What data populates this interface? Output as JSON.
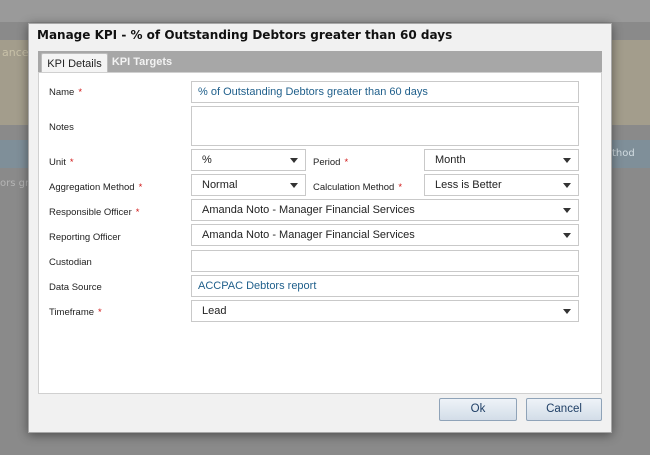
{
  "background": {
    "fragment_1": "ance",
    "fragment_2": "ors gre",
    "fragment_3": "thod"
  },
  "dialog": {
    "title": "Manage KPI - % of Outstanding Debtors greater than 60 days",
    "tabs": [
      {
        "label": "KPI Details",
        "active": true
      },
      {
        "label": "KPI Targets",
        "active": false
      }
    ],
    "fields": {
      "name": {
        "label": "Name",
        "required": true,
        "value": "% of Outstanding Debtors greater than 60 days"
      },
      "notes": {
        "label": "Notes",
        "required": false,
        "value": ""
      },
      "unit": {
        "label": "Unit",
        "required": true,
        "value": "%"
      },
      "period": {
        "label": "Period",
        "required": true,
        "value": "Month"
      },
      "aggregation_method": {
        "label": "Aggregation Method",
        "required": true,
        "value": "Normal"
      },
      "calculation_method": {
        "label": "Calculation Method",
        "required": true,
        "value": "Less is Better"
      },
      "responsible_officer": {
        "label": "Responsible Officer",
        "required": true,
        "value": "Amanda Noto - Manager Financial Services"
      },
      "reporting_officer": {
        "label": "Reporting Officer",
        "required": false,
        "value": "Amanda Noto - Manager Financial Services"
      },
      "custodian": {
        "label": "Custodian",
        "required": false,
        "value": ""
      },
      "data_source": {
        "label": "Data Source",
        "required": false,
        "value": "ACCPAC Debtors report"
      },
      "timeframe": {
        "label": "Timeframe",
        "required": true,
        "value": "Lead"
      }
    },
    "required_marker": "*",
    "buttons": {
      "ok": "Ok",
      "cancel": "Cancel"
    }
  },
  "colors": {
    "required": "#d01616",
    "link_value": "#1f5f8b",
    "tab_bar": "#a7a7a7",
    "button_text": "#1f3f66"
  },
  "icons": {
    "dropdown": "chevron-down-icon"
  }
}
